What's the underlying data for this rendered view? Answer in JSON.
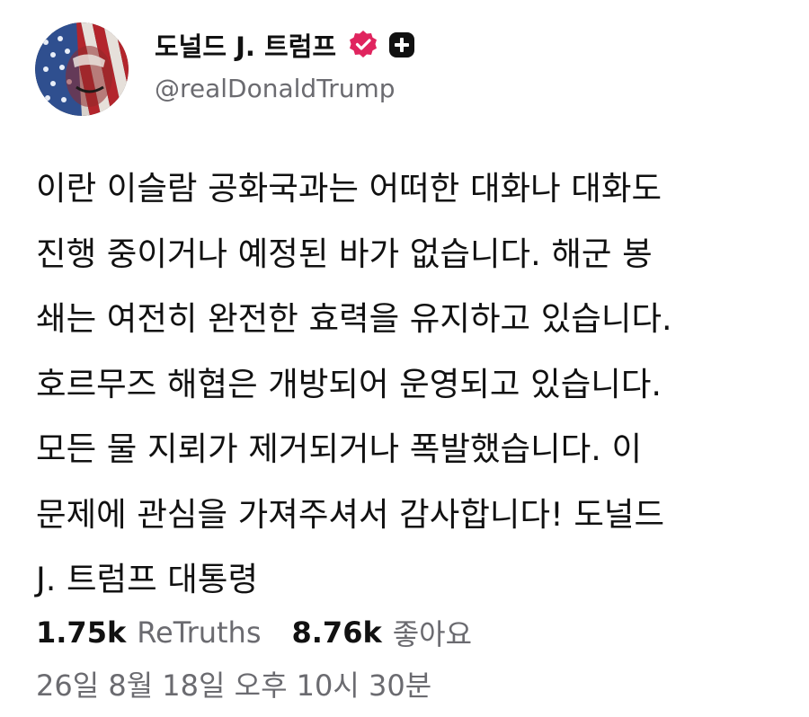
{
  "author": {
    "display_name": "도널드 J. 트럼프",
    "handle": "@realDonaldTrump",
    "verified_icon": "verified-badge-icon",
    "plus_icon": "plus-badge-icon",
    "verified_color": "#e0245e"
  },
  "post": {
    "lines": [
      "이란 이슬람 공화국과는 어떠한 대화나 대화도",
      "진행 중이거나 예정된 바가 없습니다. 해군 봉",
      "쇄는 여전히 완전한 효력을 유지하고 있습니다.",
      "호르무즈 해협은 개방되어 운영되고 있습니다.",
      "모든 물 지뢰가 제거되거나 폭발했습니다. 이",
      "문제에 관심을 가져주셔서 감사합니다! 도널드",
      "J. 트럼프 대통령"
    ]
  },
  "stats": {
    "retruths_count": "1.75k",
    "retruths_label": "ReTruths",
    "likes_count": "8.76k",
    "likes_label": "좋아요"
  },
  "timestamp": "26일 8월 18일 오후 10시 30분"
}
